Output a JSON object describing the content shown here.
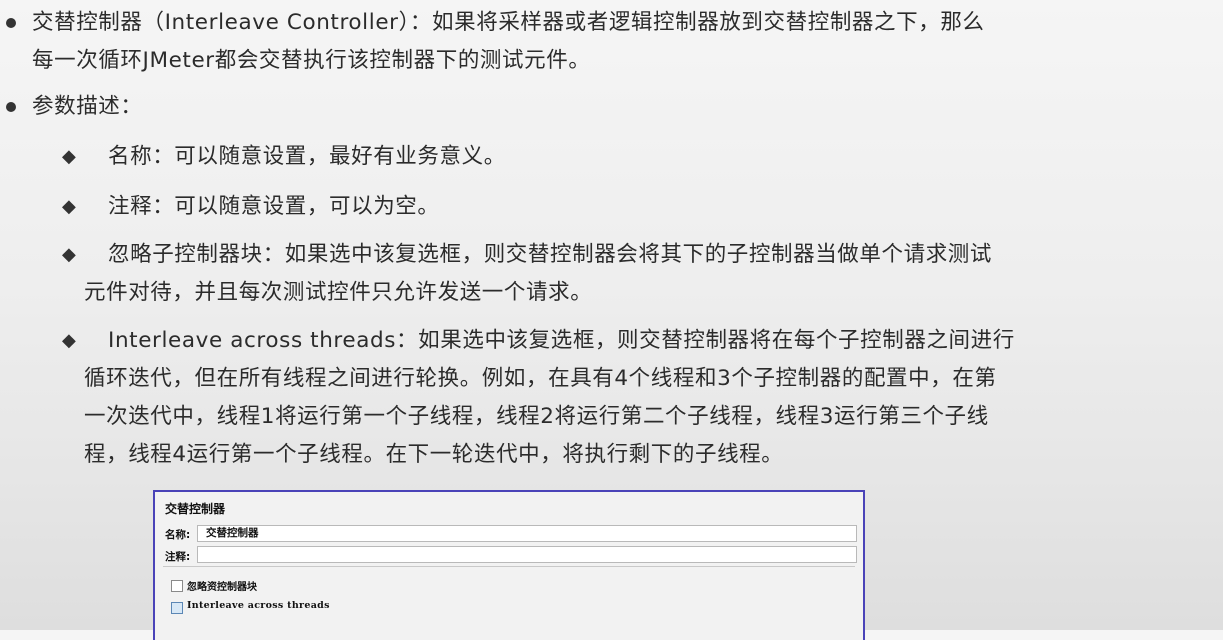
{
  "bullets": [
    {
      "lines": [
        "交替控制器（Interleave Controller）：如果将采样器或者逻辑控制器放到交替控制器之下，那么",
        "每一次循环JMeter都会交替执行该控制器下的测试元件。"
      ]
    },
    {
      "lines": [
        "参数描述："
      ]
    }
  ],
  "sub_bullets": [
    {
      "lines": [
        "名称：可以随意设置，最好有业务意义。"
      ]
    },
    {
      "lines": [
        "注释：可以随意设置，可以为空。"
      ]
    },
    {
      "lines": [
        "忽略子控制器块：如果选中该复选框，则交替控制器会将其下的子控制器当做单个请求测试",
        "元件对待，并且每次测试控件只允许发送一个请求。"
      ]
    },
    {
      "lines": [
        "Interleave across threads：如果选中该复选框，则交替控制器将在每个子控制器之间进行",
        "循环迭代，但在所有线程之间进行轮换。例如，在具有4个线程和3个子控制器的配置中，在第",
        "一次迭代中，线程1将运行第一个子线程，线程2将运行第二个子线程，线程3运行第三个子线",
        "程，线程4运行第一个子线程。在下一轮迭代中，将执行剩下的子线程。"
      ]
    }
  ],
  "panel": {
    "title": "交替控制器",
    "name_label": "名称:",
    "name_value": "交替控制器",
    "comment_label": "注释:",
    "comment_value": "",
    "checkbox_ignore": "忽略资控制器块",
    "checkbox_interleave": "Interleave across threads"
  },
  "colors": {
    "panel_border": "#4a43b8",
    "text": "#2b2b2b"
  }
}
